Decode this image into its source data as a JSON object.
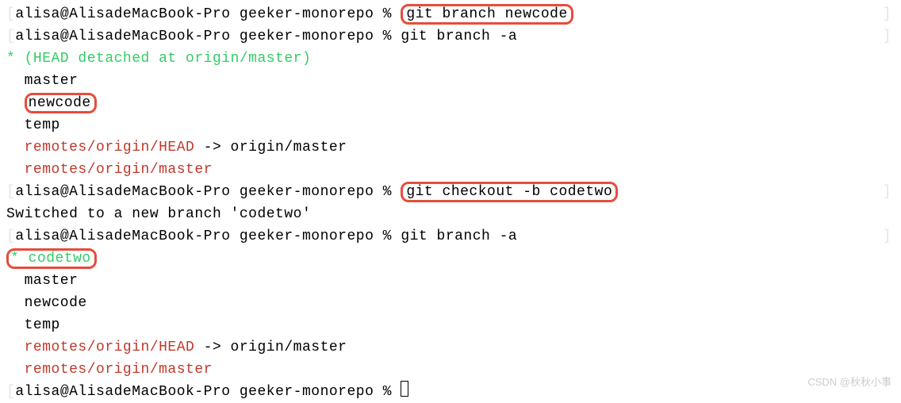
{
  "prompt": "alisa@AlisadeMacBook-Pro geeker-monorepo %",
  "commands": {
    "git_branch_newcode": "git branch newcode",
    "git_branch_a1": "git branch -a",
    "git_checkout_b_codetwo": "git checkout -b codetwo",
    "git_branch_a2": "git branch -a"
  },
  "head_detached": "* (HEAD detached at origin/master)",
  "branches1": {
    "master": "  master",
    "newcode": "newcode",
    "temp": "  temp",
    "remote_head_prefix": "  remotes/origin/HEAD",
    "remote_head_suffix": " -> origin/master",
    "remote_master": "  remotes/origin/master"
  },
  "switched": "Switched to a new branch 'codetwo'",
  "codetwo_marker": "* ",
  "codetwo_name": "codetwo",
  "branches2": {
    "master": "  master",
    "newcode": "  newcode",
    "temp": "  temp",
    "remote_head_prefix": "  remotes/origin/HEAD",
    "remote_head_suffix": " -> origin/master",
    "remote_master": "  remotes/origin/master"
  },
  "watermark": "CSDN @秋秋小事",
  "bracket": "]",
  "lbracket": "["
}
